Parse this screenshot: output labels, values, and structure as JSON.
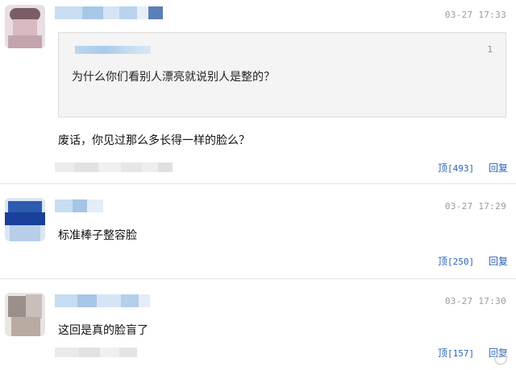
{
  "comments": [
    {
      "time": "03-27 17:33",
      "quote": {
        "floor": "1",
        "text": "为什么你们看别人漂亮就说别人是整的？"
      },
      "text": "废话，你见过那么多长得一样的脸么？",
      "upvote_label": "顶",
      "upvote_count": "[493]",
      "reply_label": "回复"
    },
    {
      "time": "03-27 17:29",
      "text": "标准棒子整容脸",
      "upvote_label": "顶",
      "upvote_count": "[250]",
      "reply_label": "回复"
    },
    {
      "time": "03-27 17:30",
      "text": "这回是真的脸盲了",
      "upvote_label": "顶",
      "upvote_count": "[157]",
      "reply_label": "回复"
    }
  ],
  "colors": {
    "link": "#2a62b8",
    "time": "#9a9a9a",
    "quote_bg": "#f4f4f4"
  }
}
